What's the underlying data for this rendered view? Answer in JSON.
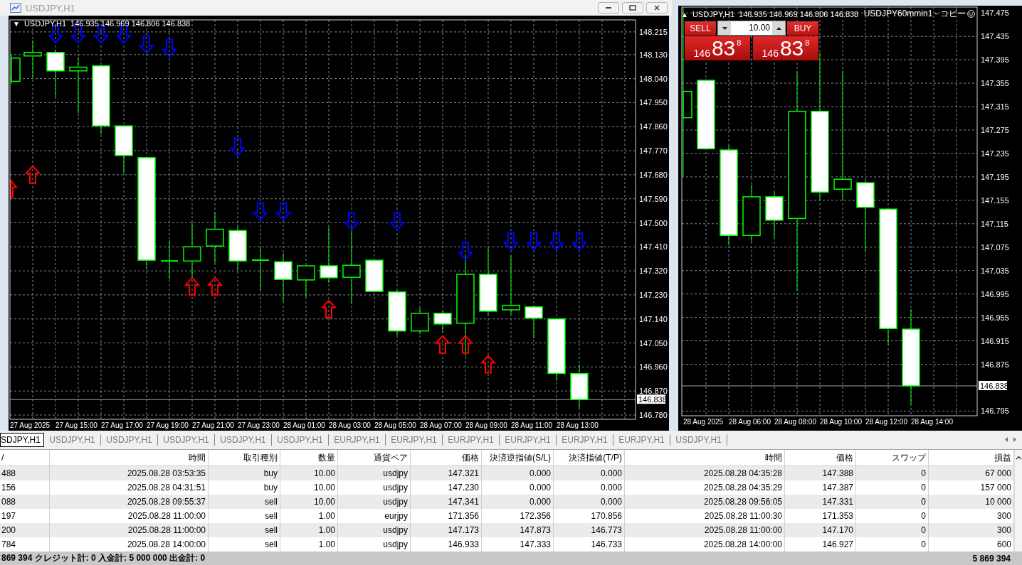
{
  "left_window": {
    "title": "USDJPY,H1",
    "chart": {
      "toggle": "▼",
      "symbol": "USDJPY,H1",
      "ohlc": "146.935 146.969 146.806 146.838",
      "last_price": "146.838",
      "price_labels": [
        "148.215",
        "148.130",
        "148.040",
        "147.950",
        "147.860",
        "147.770",
        "147.680",
        "147.590",
        "147.500",
        "147.410",
        "147.320",
        "147.230",
        "147.140",
        "147.050",
        "146.960",
        "146.870",
        "146.780"
      ],
      "time_labels": [
        "27 Aug 2025",
        "27 Aug 15:00",
        "27 Aug 17:00",
        "27 Aug 19:00",
        "27 Aug 21:00",
        "27 Aug 23:00",
        "28 Aug 01:00",
        "28 Aug 03:00",
        "28 Aug 05:00",
        "28 Aug 07:00",
        "28 Aug 09:00",
        "28 Aug 11:00",
        "28 Aug 13:00"
      ]
    }
  },
  "right_window": {
    "chart": {
      "toggle": "▲",
      "symbol": "USDJPY,H1",
      "ohlc": "146.935 146.969 146.806 146.838",
      "indicator": "USDJPY60mmin1 - コピー",
      "last_price": "146.838",
      "price_labels": [
        "147.475",
        "147.435",
        "147.395",
        "147.355",
        "147.315",
        "147.275",
        "147.235",
        "147.195",
        "147.155",
        "147.115",
        "147.075",
        "147.035",
        "146.995",
        "146.955",
        "146.915",
        "146.875",
        "146.795"
      ],
      "time_labels": [
        "28 Aug 2025",
        "28 Aug 06:00",
        "28 Aug 08:00",
        "28 Aug 10:00",
        "28 Aug 12:00",
        "28 Aug 14:00"
      ]
    },
    "trade_panel": {
      "sell_label": "SELL",
      "buy_label": "BUY",
      "volume": "10.00",
      "sell_price": {
        "big_figure": "146",
        "pips": "83",
        "point": "8"
      },
      "buy_price": {
        "big_figure": "146",
        "pips": "83",
        "point": "8"
      }
    }
  },
  "chart_tabs": [
    {
      "label": "SDJPY,H1",
      "selected": true
    },
    {
      "label": "USDJPY,H1",
      "selected": false
    },
    {
      "label": "USDJPY,H1",
      "selected": false
    },
    {
      "label": "USDJPY,H1",
      "selected": false
    },
    {
      "label": "USDJPY,H1",
      "selected": false
    },
    {
      "label": "USDJPY,H1",
      "selected": false
    },
    {
      "label": "EURJPY,H1",
      "selected": false
    },
    {
      "label": "EURJPY,H1",
      "selected": false
    },
    {
      "label": "EURJPY,H1",
      "selected": false
    },
    {
      "label": "EURJPY,H1",
      "selected": false
    },
    {
      "label": "EURJPY,H1",
      "selected": false
    },
    {
      "label": "EURJPY,H1",
      "selected": false
    },
    {
      "label": "USDJPY,H1",
      "selected": false
    }
  ],
  "trade_table": {
    "columns": [
      "/",
      "時間",
      "取引種別",
      "数量",
      "通貨ペア",
      "価格",
      "決済逆指値(S/L)",
      "決済指値(T/P)",
      "時間",
      "価格",
      "スワップ",
      "損益"
    ],
    "rows": [
      [
        "488",
        "2025.08.28 03:53:35",
        "buy",
        "10.00",
        "usdjpy",
        "147.321",
        "0.000",
        "0.000",
        "2025.08.28 04:35:28",
        "147.388",
        "0",
        "67 000"
      ],
      [
        "156",
        "2025.08.28 04:31:51",
        "buy",
        "10.00",
        "usdjpy",
        "147.230",
        "0.000",
        "0.000",
        "2025.08.28 04:35:29",
        "147.387",
        "0",
        "157 000"
      ],
      [
        "088",
        "2025.08.28 09:55:37",
        "sell",
        "10.00",
        "usdjpy",
        "147.341",
        "0.000",
        "0.000",
        "2025.08.28 09:56:05",
        "147.331",
        "0",
        "10 000"
      ],
      [
        "197",
        "2025.08.28 11:00:00",
        "sell",
        "1.00",
        "eurjpy",
        "171.356",
        "172.356",
        "170.856",
        "2025.08.28 11:00:30",
        "171.353",
        "0",
        "300"
      ],
      [
        "200",
        "2025.08.28 11:00:00",
        "sell",
        "1.00",
        "usdjpy",
        "147.173",
        "147.873",
        "146.773",
        "2025.08.28 11:00:00",
        "147.170",
        "0",
        "300"
      ],
      [
        "784",
        "2025.08.28 14:00:00",
        "sell",
        "1.00",
        "usdjpy",
        "146.933",
        "147.333",
        "146.733",
        "2025.08.28 14:00:00",
        "146.927",
        "0",
        "600"
      ]
    ],
    "footer": {
      "summary": "869 394  クレジット計: 0  入金計: 5 000 000  出金計: 0",
      "total": "5 869 394"
    }
  }
}
